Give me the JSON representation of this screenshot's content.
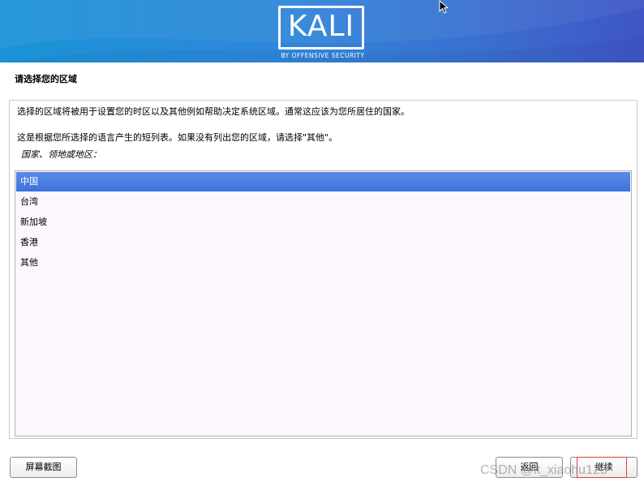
{
  "header": {
    "logo_text": "KALI",
    "logo_subtitle": "BY OFFENSIVE SECURITY"
  },
  "page": {
    "title": "请选择您的区域",
    "description_1": "选择的区域将被用于设置您的时区以及其他例如帮助决定系统区域。通常这应该为您所居住的国家。",
    "description_2": "这是根据您所选择的语言产生的短列表。如果没有列出您的区域，请选择\"其他\"。",
    "field_label": "国家、领地或地区："
  },
  "region_list": {
    "selected_index": 0,
    "items": [
      "中国",
      "台湾",
      "新加坡",
      "香港",
      "其他"
    ]
  },
  "buttons": {
    "screenshot": "屏幕截图",
    "back": "返回",
    "continue": "继续"
  },
  "watermark": "CSDN @it_xiaohu123",
  "colors": {
    "banner_start": "#1a93d6",
    "banner_end": "#3f55c6",
    "selection": "#3d72dc",
    "listbox_bg": "#fbf7fd"
  }
}
